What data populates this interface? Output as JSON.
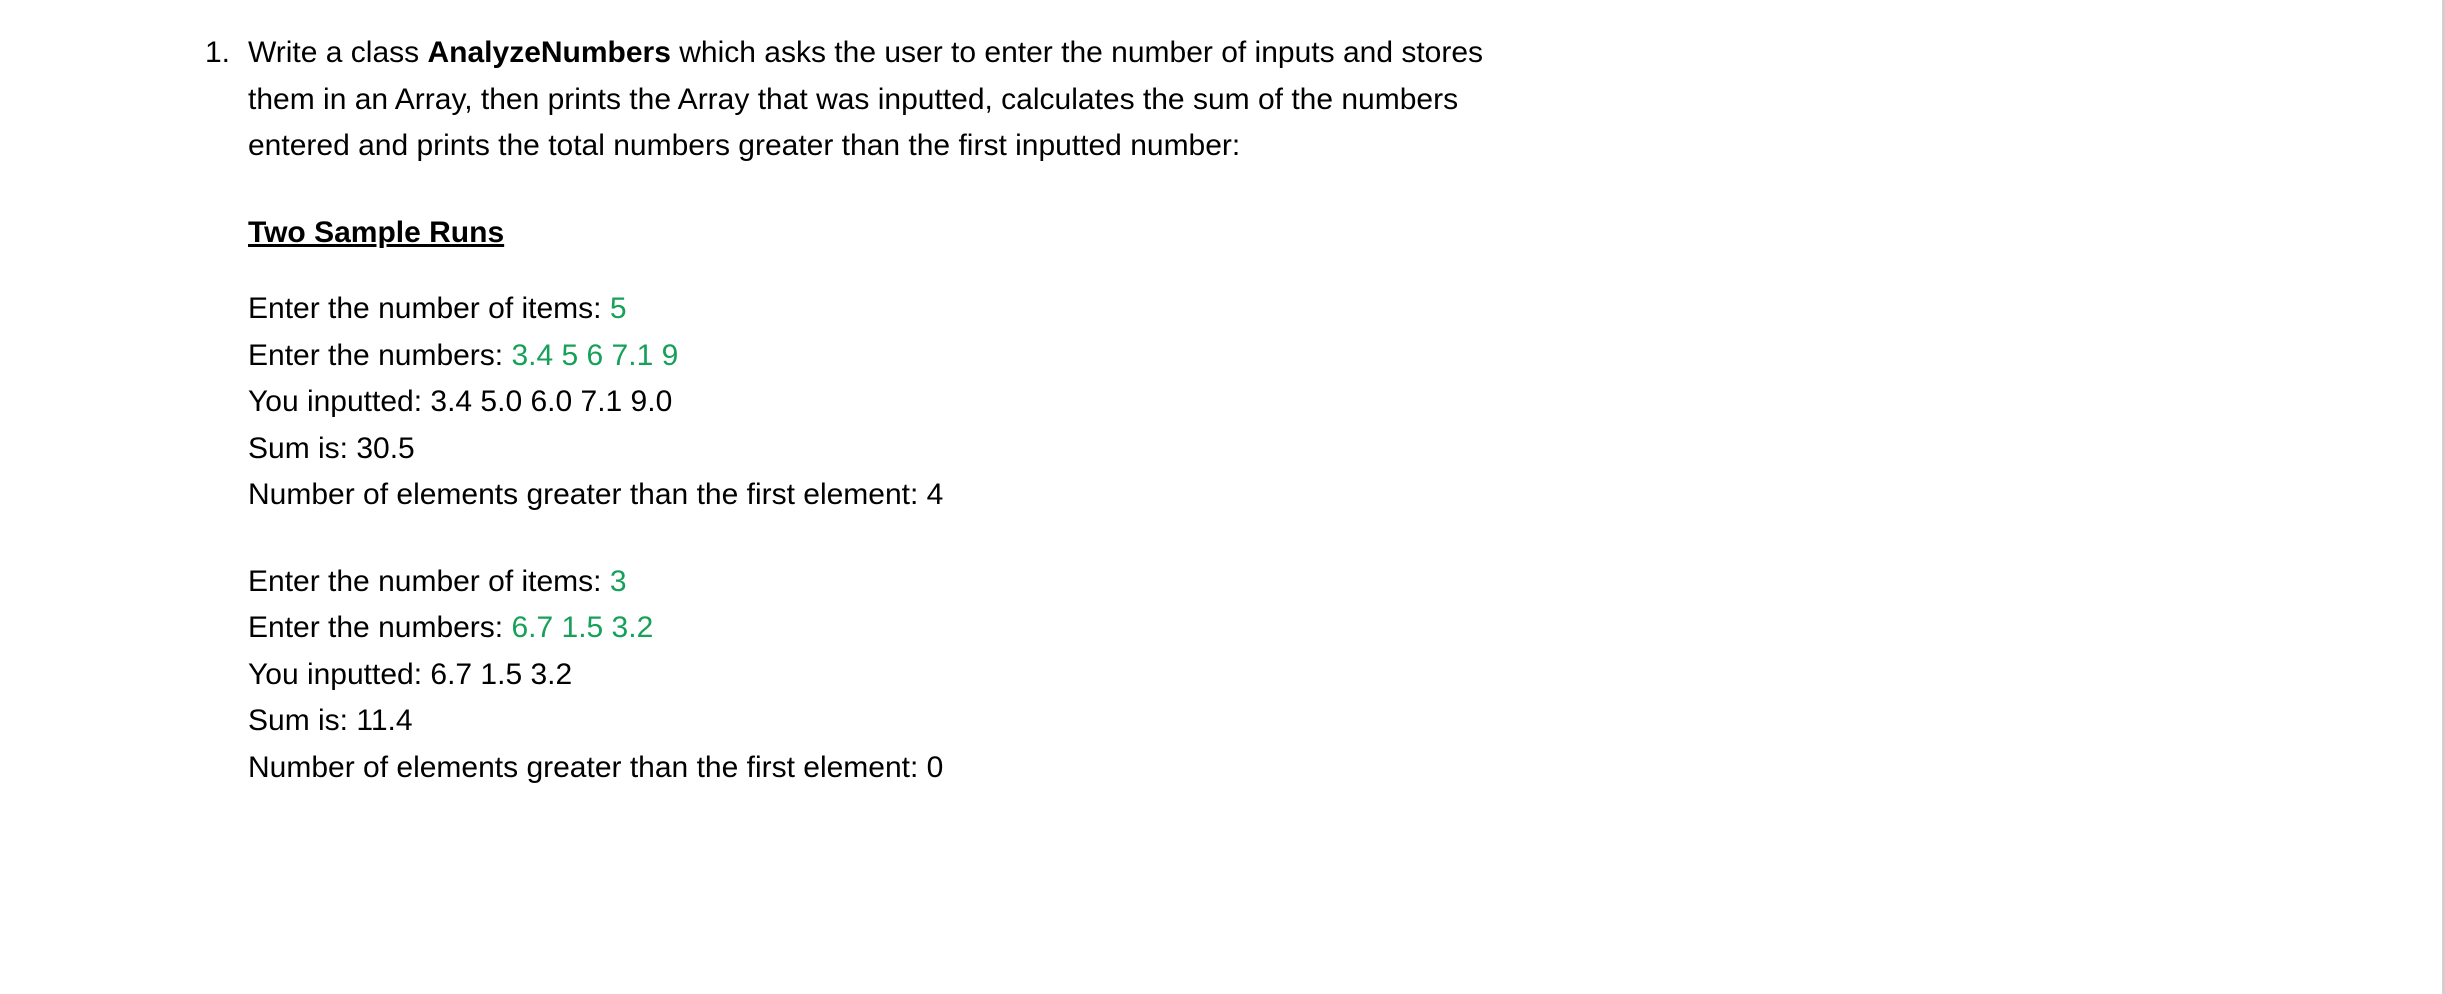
{
  "list": {
    "marker": "1."
  },
  "problem": {
    "text_before_class": "Write a class ",
    "class_name": "AnalyzeNumbers",
    "text_after_class": " which asks the user to enter the number of inputs and stores them in an Array, then prints the Array that was inputted, calculates the sum of the numbers entered and prints the total numbers greater than the first inputted number:"
  },
  "section_heading": "Two Sample Runs",
  "runs": [
    {
      "items_prompt": "Enter the number of items: ",
      "items_value": "5",
      "numbers_prompt": "Enter the numbers: ",
      "numbers_value": "3.4 5 6 7.1 9",
      "inputted_line": "You inputted: 3.4 5.0 6.0 7.1 9.0",
      "sum_line": "Sum is: 30.5",
      "greater_line": "Number of elements greater than the first element: 4"
    },
    {
      "items_prompt": "Enter the number of items: ",
      "items_value": "3",
      "numbers_prompt": "Enter the numbers: ",
      "numbers_value": "6.7 1.5 3.2",
      "inputted_line": "You inputted: 6.7 1.5 3.2",
      "sum_line": "Sum is: 11.4",
      "greater_line": "Number of elements greater than the first element: 0"
    }
  ]
}
